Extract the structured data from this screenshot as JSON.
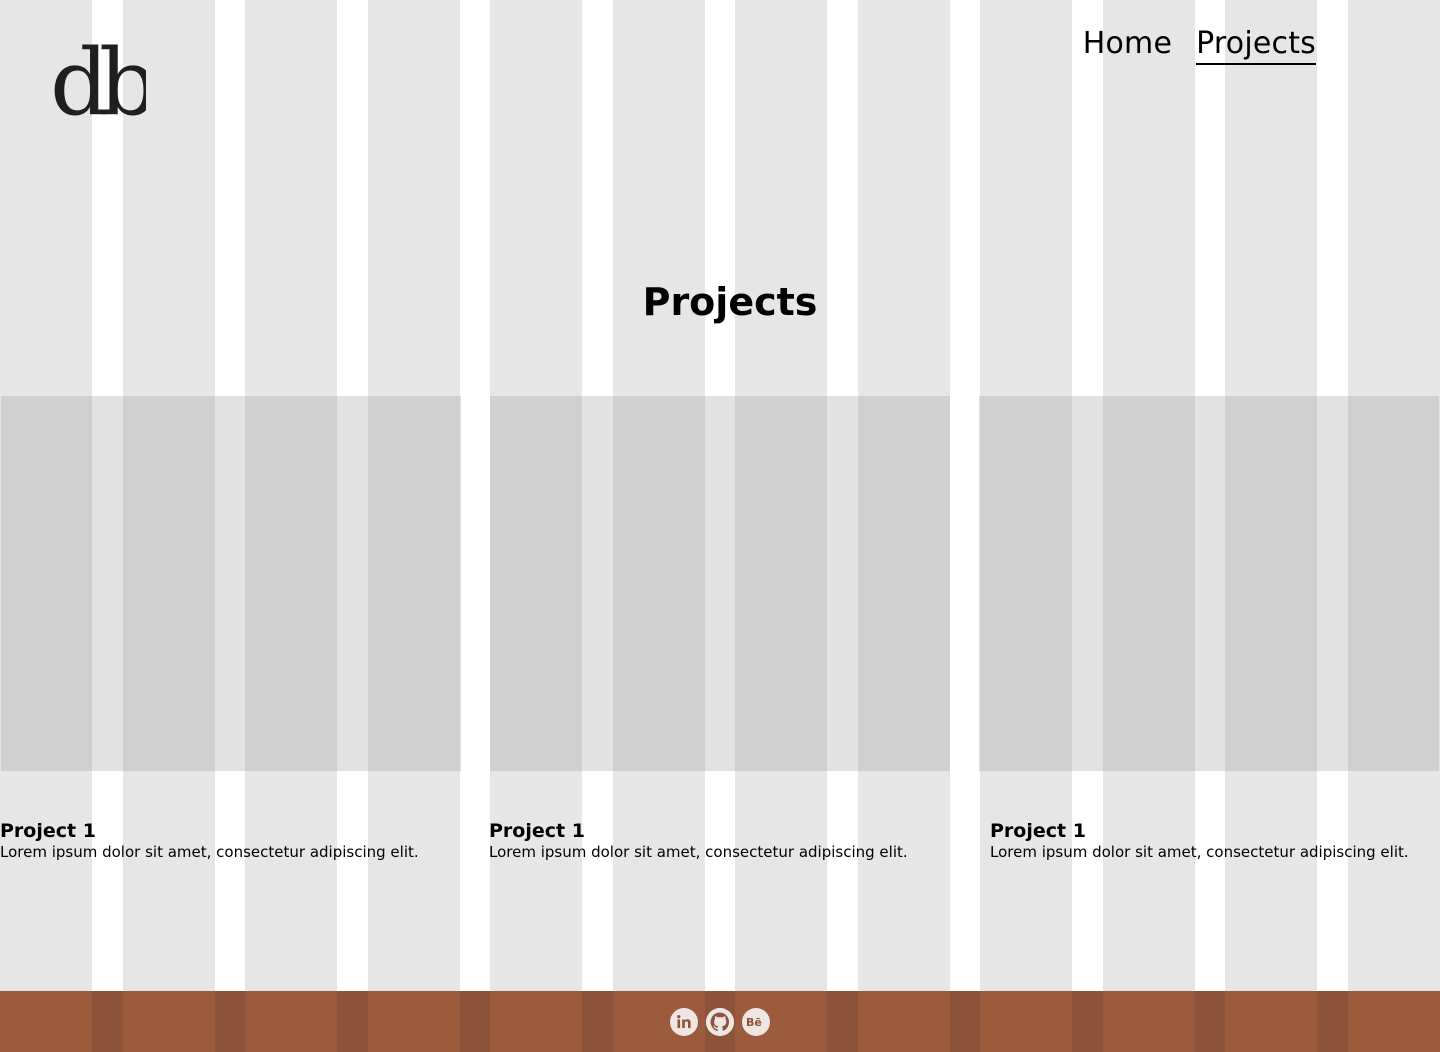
{
  "header": {
    "logo_text": "db",
    "nav": [
      {
        "label": "Home"
      },
      {
        "label": "Projects"
      }
    ]
  },
  "main": {
    "title": "Projects",
    "cards": [
      {
        "title": "Project 1",
        "desc": "Lorem ipsum dolor sit amet, consectetur adipiscing elit."
      },
      {
        "title": "Project 1",
        "desc": "Lorem ipsum dolor sit amet, consectetur adipiscing elit."
      },
      {
        "title": "Project 1",
        "desc": "Lorem ipsum dolor sit amet, consectetur adipiscing elit."
      }
    ]
  },
  "footer": {
    "icons": [
      "linkedin-icon",
      "github-icon",
      "behance-icon"
    ]
  },
  "colors": {
    "footer": "#8d523a",
    "grid_column": "#e6e6e6",
    "placeholder": "#c4c4c4"
  }
}
